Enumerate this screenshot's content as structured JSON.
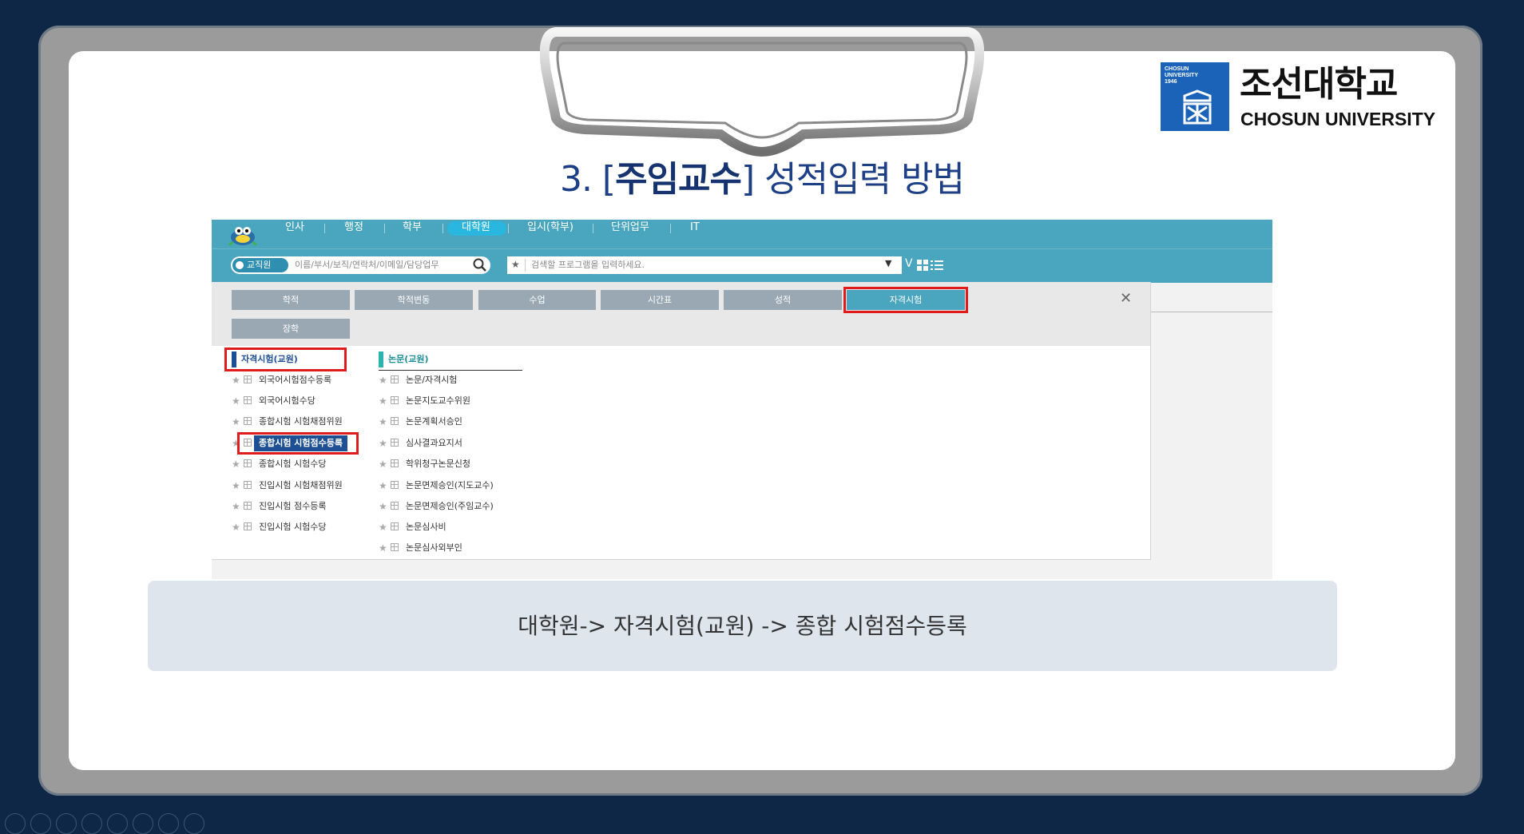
{
  "slide": {
    "title_prefix": "3. [",
    "title_highlight": "주임교수",
    "title_suffix": "] 성적입력 방법",
    "caption": "대학원->  자격시험(교원) -> 종합 시험점수등록"
  },
  "logo": {
    "box_line1": "CHOSUN",
    "box_line2": "UNIVERSITY",
    "box_line3": "1946",
    "name_ko": "조선대학교",
    "name_en": "CHOSUN UNIVERSITY"
  },
  "topnav": {
    "items": [
      "인사",
      "행정",
      "학부",
      "대학원",
      "입시(학부)",
      "단위업무",
      "IT"
    ],
    "active": "대학원"
  },
  "search": {
    "scope_label": "교직원",
    "people_placeholder": "이름/부서/보직/연락처/이메일/담당업무",
    "program_placeholder": "검색할 프로그램을 입력하세요.",
    "view_toggle": "V"
  },
  "tabs": [
    "학적",
    "학적변동",
    "수업",
    "시간표",
    "성적",
    "자격시험",
    "장학"
  ],
  "active_tab": "자격시험",
  "menu": {
    "col1_header": "자격시험(교원)",
    "col1_items": [
      "외국어시험점수등록",
      "외국어시험수당",
      "종합시험 시험채점위원",
      "종합시험 시험점수등록",
      "종합시험 시험수당",
      "진입시험 시험채점위원",
      "진입시험 점수등록",
      "진입시험 시험수당"
    ],
    "col1_highlight": "종합시험 시험점수등록",
    "col2_header": "논문(교원)",
    "col2_items": [
      "논문/자격시험",
      "논문지도교수위원",
      "논문계획서승인",
      "심사결과요지서",
      "학위청구논문신청",
      "논문면제승인(지도교수)",
      "논문면제승인(주임교수)",
      "논문심사비",
      "논문심사외부인"
    ]
  },
  "colors": {
    "nav_teal": "#4aa6bf",
    "tab_gray": "#9aa8b3",
    "highlight_red": "#e01b1b",
    "highlight_blue": "#1d4f94",
    "title_blue": "#16336f"
  }
}
